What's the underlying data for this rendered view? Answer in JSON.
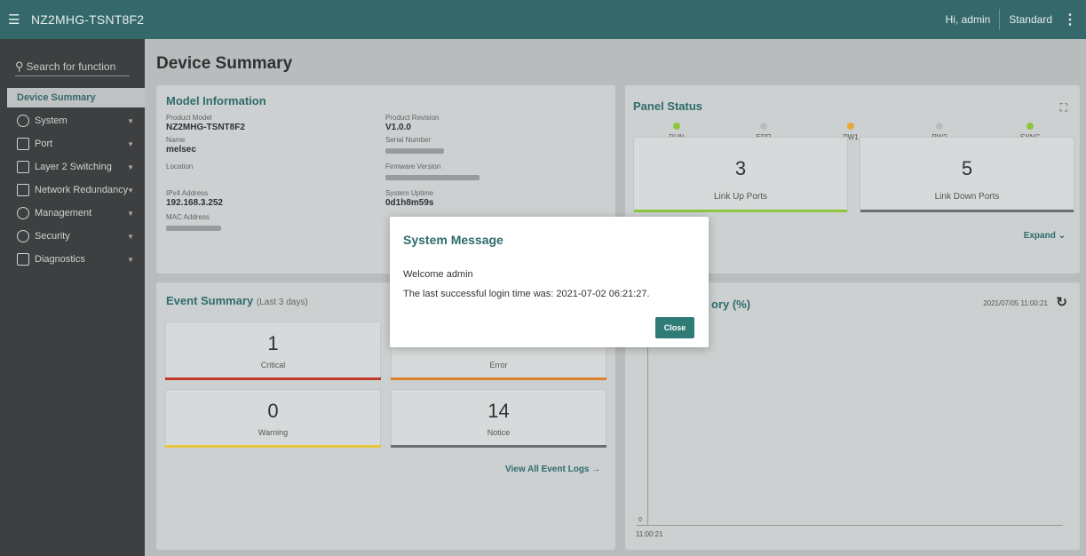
{
  "topbar": {
    "device_name": "NZ2MHG-TSNT8F2",
    "user": "Hi, admin",
    "mode": "Standard",
    "menu_icon": "☰",
    "more_icon": "⋮"
  },
  "sidebar": {
    "search_placeholder": "Search for function",
    "active": "Device Summary",
    "items": [
      {
        "label": "System",
        "icon": "gear-icon"
      },
      {
        "label": "Port",
        "icon": "port-icon"
      },
      {
        "label": "Layer 2 Switching",
        "icon": "switch-icon"
      },
      {
        "label": "Network Redundancy",
        "icon": "redundancy-icon"
      },
      {
        "label": "Management",
        "icon": "management-icon"
      },
      {
        "label": "Security",
        "icon": "security-icon"
      },
      {
        "label": "Diagnostics",
        "icon": "diagnostics-icon"
      }
    ]
  },
  "page": {
    "title": "Device Summary"
  },
  "model_info": {
    "title": "Model Information",
    "product_model_label": "Product Model",
    "product_model": "NZ2MHG-TSNT8F2",
    "name_label": "Name",
    "name": "melsec",
    "location_label": "Location",
    "ipv4_label": "IPv4 Address",
    "ipv4": "192.168.3.252",
    "mac_label": "MAC Address",
    "product_revision_label": "Product Revision",
    "product_revision": "V1.0.0",
    "serial_label": "Serial Number",
    "firmware_label": "Firmware Version",
    "uptime_label": "System Uptime",
    "uptime": "0d1h8m59s"
  },
  "panel_status": {
    "title": "Panel Status",
    "leds": [
      {
        "label": "RUN",
        "color": "#8dc63f"
      },
      {
        "label": "ERR",
        "color": "#b8bcbc"
      },
      {
        "label": "PW1",
        "color": "#e9a83a"
      },
      {
        "label": "PW2",
        "color": "#b8bcbc"
      },
      {
        "label": "SYNC",
        "color": "#8dc63f"
      }
    ],
    "link_up": {
      "value": "3",
      "label": "Link Up Ports",
      "color": "#8dc63f"
    },
    "link_down": {
      "value": "5",
      "label": "Link Down Ports",
      "color": "#6a6e6e"
    },
    "expand_label": "Expand"
  },
  "event_summary": {
    "title": "Event Summary",
    "subtitle": "(Last 3 days)",
    "boxes": [
      {
        "value": "1",
        "label": "Critical",
        "color": "#c0392b"
      },
      {
        "value": "",
        "label": "Error",
        "color": "#d9822b"
      },
      {
        "value": "0",
        "label": "Warning",
        "color": "#e8c53a"
      },
      {
        "value": "14",
        "label": "Notice",
        "color": "#6a6e6e"
      }
    ],
    "view_all": "View All Event Logs →"
  },
  "memory": {
    "title_partial": "ory (%)",
    "timestamp": "2021/07/05 11:00:21",
    "y_zero": "0",
    "x_tick": "11:00:21"
  },
  "dialog": {
    "title": "System Message",
    "line1": "Welcome admin",
    "line2": "The last successful login time was: 2021-07-02 06:21:27.",
    "close": "Close"
  }
}
